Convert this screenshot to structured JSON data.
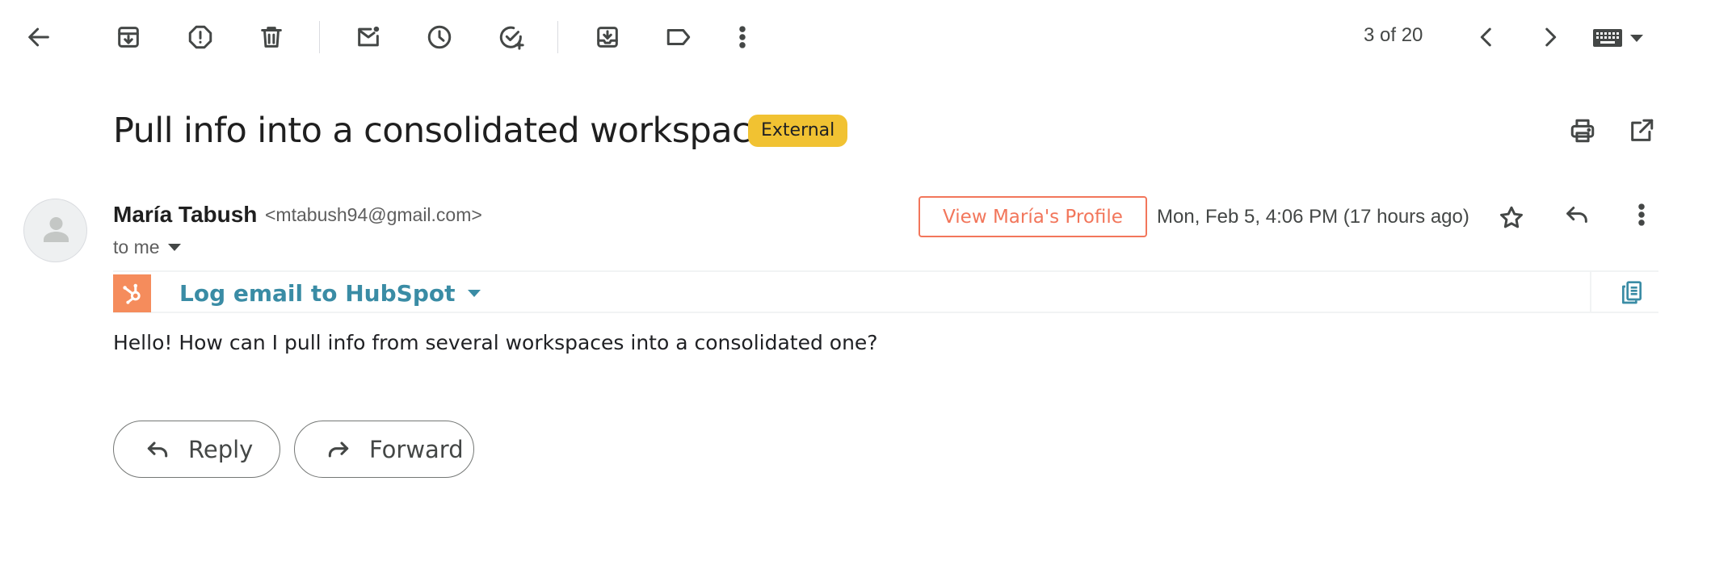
{
  "toolbar": {
    "back": "back-arrow-icon",
    "archive": "archive-icon",
    "report_spam": "report-spam-icon",
    "delete": "trash-icon",
    "mark_unread": "mark-unread-icon",
    "snooze": "clock-icon",
    "add_task": "add-task-icon",
    "move_to": "move-to-icon",
    "labels": "label-icon",
    "more": "more-vert-icon",
    "pagination": "3 of 20",
    "input_tools": "keyboard-icon"
  },
  "email": {
    "subject": "Pull info into a consolidated workspace",
    "badge": "External",
    "sender_name": "María Tabush",
    "sender_email": "<mtabush94@gmail.com>",
    "recipient": "to me",
    "profile_button": "View María's Profile",
    "date": "Mon, Feb 5, 4:06 PM (17 hours ago)",
    "body": "Hello! How can I pull info from several workspaces into a consolidated one?"
  },
  "hubspot": {
    "log_label": "Log email to HubSpot",
    "brand_color": "#f58c5c",
    "link_color": "#3a8ca5"
  },
  "actions": {
    "reply": "Reply",
    "forward": "Forward"
  },
  "colors": {
    "badge": "#f1c232",
    "profile_accent": "#f2765b"
  }
}
